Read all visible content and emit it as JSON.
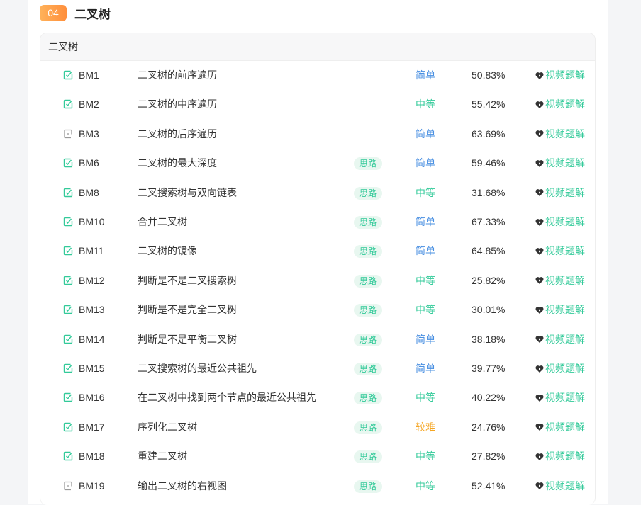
{
  "section": {
    "number": "04",
    "title": "二叉树"
  },
  "panel": {
    "header": "二叉树"
  },
  "colors": {
    "easy": "#4a90e2",
    "medium": "#32ca99",
    "hard": "#f5a623",
    "accent": "#32ca99",
    "badge": "#ff9a46"
  },
  "problems": [
    {
      "code": "BM1",
      "title": "二叉树的前序遍历",
      "idea": "",
      "difficulty": "简单",
      "level": "easy",
      "rate": "50.83%",
      "video": "视频题解",
      "status": "done"
    },
    {
      "code": "BM2",
      "title": "二叉树的中序遍历",
      "idea": "",
      "difficulty": "中等",
      "level": "medium",
      "rate": "55.42%",
      "video": "视频题解",
      "status": "done"
    },
    {
      "code": "BM3",
      "title": "二叉树的后序遍历",
      "idea": "",
      "difficulty": "简单",
      "level": "easy",
      "rate": "63.69%",
      "video": "视频题解",
      "status": "todo"
    },
    {
      "code": "BM6",
      "title": "二叉树的最大深度",
      "idea": "思路",
      "difficulty": "简单",
      "level": "easy",
      "rate": "59.46%",
      "video": "视频题解",
      "status": "done"
    },
    {
      "code": "BM8",
      "title": "二叉搜索树与双向链表",
      "idea": "思路",
      "difficulty": "中等",
      "level": "medium",
      "rate": "31.68%",
      "video": "视频题解",
      "status": "done"
    },
    {
      "code": "BM10",
      "title": "合并二叉树",
      "idea": "思路",
      "difficulty": "简单",
      "level": "easy",
      "rate": "67.33%",
      "video": "视频题解",
      "status": "done"
    },
    {
      "code": "BM11",
      "title": "二叉树的镜像",
      "idea": "思路",
      "difficulty": "简单",
      "level": "easy",
      "rate": "64.85%",
      "video": "视频题解",
      "status": "done"
    },
    {
      "code": "BM12",
      "title": "判断是不是二叉搜索树",
      "idea": "思路",
      "difficulty": "中等",
      "level": "medium",
      "rate": "25.82%",
      "video": "视频题解",
      "status": "done"
    },
    {
      "code": "BM13",
      "title": "判断是不是完全二叉树",
      "idea": "思路",
      "difficulty": "中等",
      "level": "medium",
      "rate": "30.01%",
      "video": "视频题解",
      "status": "done"
    },
    {
      "code": "BM14",
      "title": "判断是不是平衡二叉树",
      "idea": "思路",
      "difficulty": "简单",
      "level": "easy",
      "rate": "38.18%",
      "video": "视频题解",
      "status": "done"
    },
    {
      "code": "BM15",
      "title": "二叉搜索树的最近公共祖先",
      "idea": "思路",
      "difficulty": "简单",
      "level": "easy",
      "rate": "39.77%",
      "video": "视频题解",
      "status": "done"
    },
    {
      "code": "BM16",
      "title": "在二叉树中找到两个节点的最近公共祖先",
      "idea": "思路",
      "difficulty": "中等",
      "level": "medium",
      "rate": "40.22%",
      "video": "视频题解",
      "status": "done"
    },
    {
      "code": "BM17",
      "title": "序列化二叉树",
      "idea": "思路",
      "difficulty": "较难",
      "level": "hard",
      "rate": "24.76%",
      "video": "视频题解",
      "status": "done"
    },
    {
      "code": "BM18",
      "title": "重建二叉树",
      "idea": "思路",
      "difficulty": "中等",
      "level": "medium",
      "rate": "27.82%",
      "video": "视频题解",
      "status": "done"
    },
    {
      "code": "BM19",
      "title": "输出二叉树的右视图",
      "idea": "思路",
      "difficulty": "中等",
      "level": "medium",
      "rate": "52.41%",
      "video": "视频题解",
      "status": "todo"
    }
  ]
}
